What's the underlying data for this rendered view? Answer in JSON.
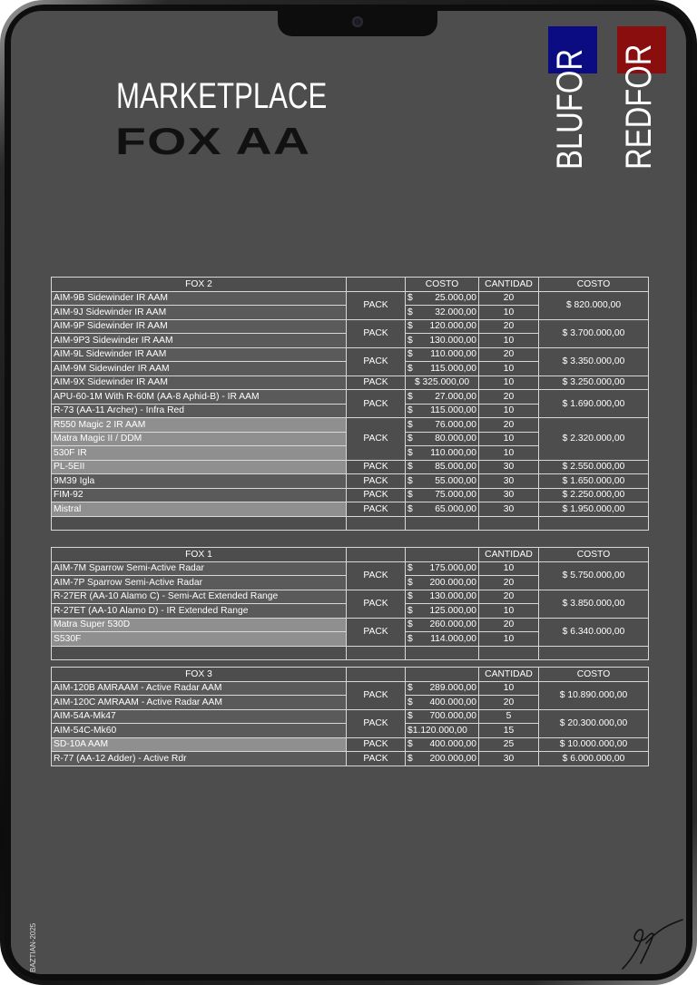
{
  "header": {
    "title": "MARKETPLACE",
    "subtitle": "FOX AA"
  },
  "factions": [
    {
      "label": "BLUFOR",
      "color": "#0b0b82"
    },
    {
      "label": "REDFOR",
      "color": "#8a0e0e"
    }
  ],
  "credit": "BAZTIAN-2025",
  "table": {
    "pack_label": "PACK",
    "fox2": {
      "title": "FOX 2",
      "h_costo": "COSTO",
      "h_cantidad": "CANTIDAD",
      "h_total": "COSTO",
      "rows": [
        {
          "name": "AIM-9B Sidewinder IR AAM",
          "cost": "25.000,00",
          "qty": "20"
        },
        {
          "name": "AIM-9J Sidewinder IR AAM",
          "cost": "32.000,00",
          "qty": "10"
        },
        {
          "name": "AIM-9P Sidewinder IR AAM",
          "cost": "120.000,00",
          "qty": "20"
        },
        {
          "name": "AIM-9P3 Sidewinder IR AAM",
          "cost": "130.000,00",
          "qty": "10"
        },
        {
          "name": "AIM-9L Sidewinder IR AAM",
          "cost": "110.000,00",
          "qty": "20"
        },
        {
          "name": "AIM-9M Sidewinder IR AAM",
          "cost": "115.000,00",
          "qty": "10"
        },
        {
          "name": "AIM-9X Sidewinder IR AAM",
          "cost": "$ 325.000,00",
          "qty": "10"
        },
        {
          "name": "APU-60-1M With R-60M (AA-8 Aphid-B) - IR AAM",
          "cost": "27.000,00",
          "qty": "20"
        },
        {
          "name": "R-73 (AA-11 Archer) -  Infra Red",
          "cost": "115.000,00",
          "qty": "10"
        },
        {
          "name": "R550 Magic 2 IR AAM",
          "cost": "76.000,00",
          "qty": "20"
        },
        {
          "name": "Matra Magic II / DDM",
          "cost": "80.000,00",
          "qty": "10"
        },
        {
          "name": "530F IR",
          "cost": "110.000,00",
          "qty": "10"
        },
        {
          "name": "PL-5EII",
          "cost": "85.000,00",
          "qty": "30"
        },
        {
          "name": "9M39 Igla",
          "cost": "55.000,00",
          "qty": "30"
        },
        {
          "name": "FIM-92",
          "cost": "75.000,00",
          "qty": "30"
        },
        {
          "name": "Mistral",
          "cost": "65.000,00",
          "qty": "30"
        }
      ],
      "totals": [
        "$ 820.000,00",
        "$ 3.700.000,00",
        "$ 3.350.000,00",
        "$ 3.250.000,00",
        "$ 1.690.000,00",
        "$ 2.320.000,00",
        "$ 2.550.000,00",
        "$ 1.650.000,00",
        "$ 2.250.000,00",
        "$ 1.950.000,00"
      ]
    },
    "fox1": {
      "title": "FOX 1",
      "h_cantidad": "CANTIDAD",
      "h_total": "COSTO",
      "rows": [
        {
          "name": "AIM-7M Sparrow Semi-Active Radar",
          "cost": "175.000,00",
          "qty": "10"
        },
        {
          "name": "AIM-7P Sparrow Semi-Active Radar",
          "cost": "200.000,00",
          "qty": "20"
        },
        {
          "name": "R-27ER (AA-10 Alamo C) - Semi-Act Extended Range",
          "cost": "130.000,00",
          "qty": "20"
        },
        {
          "name": "R-27ET (AA-10 Alamo D) - IR Extended Range",
          "cost": "125.000,00",
          "qty": "10"
        },
        {
          "name": "Matra Super 530D",
          "cost": "260.000,00",
          "qty": "20"
        },
        {
          "name": "S530F",
          "cost": "114.000,00",
          "qty": "10"
        }
      ],
      "totals": [
        "$ 5.750.000,00",
        "$ 3.850.000,00",
        "$ 6.340.000,00"
      ]
    },
    "fox3": {
      "title": "FOX 3",
      "h_cantidad": "CANTIDAD",
      "h_total": "COSTO",
      "rows": [
        {
          "name": "AIM-120B AMRAAM - Active Radar AAM",
          "cost": "289.000,00",
          "qty": "10"
        },
        {
          "name": "AIM-120C AMRAAM - Active Radar AAM",
          "cost": "400.000,00",
          "qty": "20"
        },
        {
          "name": "AIM-54A-Mk47",
          "cost": "700.000,00",
          "qty": "5"
        },
        {
          "name": "AIM-54C-Mk60",
          "cost": "$1.120.000,00",
          "qty": "15"
        },
        {
          "name": "SD-10A AAM",
          "cost": "400.000,00",
          "qty": "25"
        },
        {
          "name": "R-77 (AA-12 Adder) - Active Rdr",
          "cost": "200.000,00",
          "qty": "30"
        }
      ],
      "totals": [
        "$ 10.890.000,00",
        "$ 20.300.000,00",
        "$ 10.000.000,00",
        "$ 6.000.000,00"
      ]
    }
  }
}
